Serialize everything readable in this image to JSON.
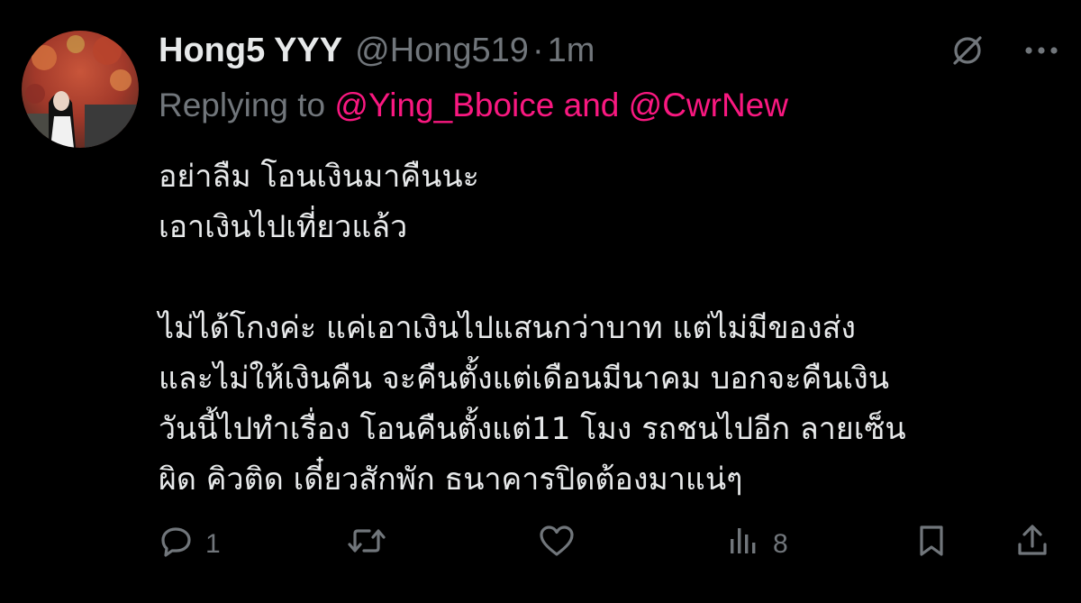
{
  "tweet": {
    "display_name": "Hong5 YYY",
    "handle": "@Hong519",
    "separator": "·",
    "time": "1m",
    "reply": {
      "prefix": "Replying to ",
      "mention1": "@Ying_Bboice",
      "conjunction": " and ",
      "mention2": "@CwrNew"
    },
    "body_lines": [
      "อย่าลืม โอนเงินมาคืนนะ",
      "เอาเงินไปเที่ยวแล้ว",
      "",
      "ไม่ได้โกงค่ะ แค่เอาเงินไปแสนกว่าบาท แต่ไม่มีของส่ง",
      "และไม่ให้เงินคืน จะคืนตั้งแต่เดือนมีนาคม บอกจะคืนเงิน",
      "วันนี้ไปทำเรื่อง โอนคืนตั้งแต่11 โมง รถชนไปอีก ลายเซ็น",
      "ผิด คิวติด เดี๋ยวสักพัก ธนาคารปิดต้องมาแน่ๆ"
    ],
    "stats": {
      "replies": "1",
      "retweets": "",
      "likes": "",
      "views": "8"
    }
  },
  "icons": {
    "grok": "grok-slash-icon",
    "more": "more-dots-icon",
    "reply": "reply-bubble-icon",
    "retweet": "retweet-icon",
    "like": "heart-icon",
    "views": "analytics-bars-icon",
    "bookmark": "bookmark-icon",
    "share": "share-upload-icon"
  },
  "colors": {
    "background": "#000000",
    "primary_text": "#e7e9ea",
    "secondary_text": "#71767b",
    "mention": "#f91880"
  }
}
